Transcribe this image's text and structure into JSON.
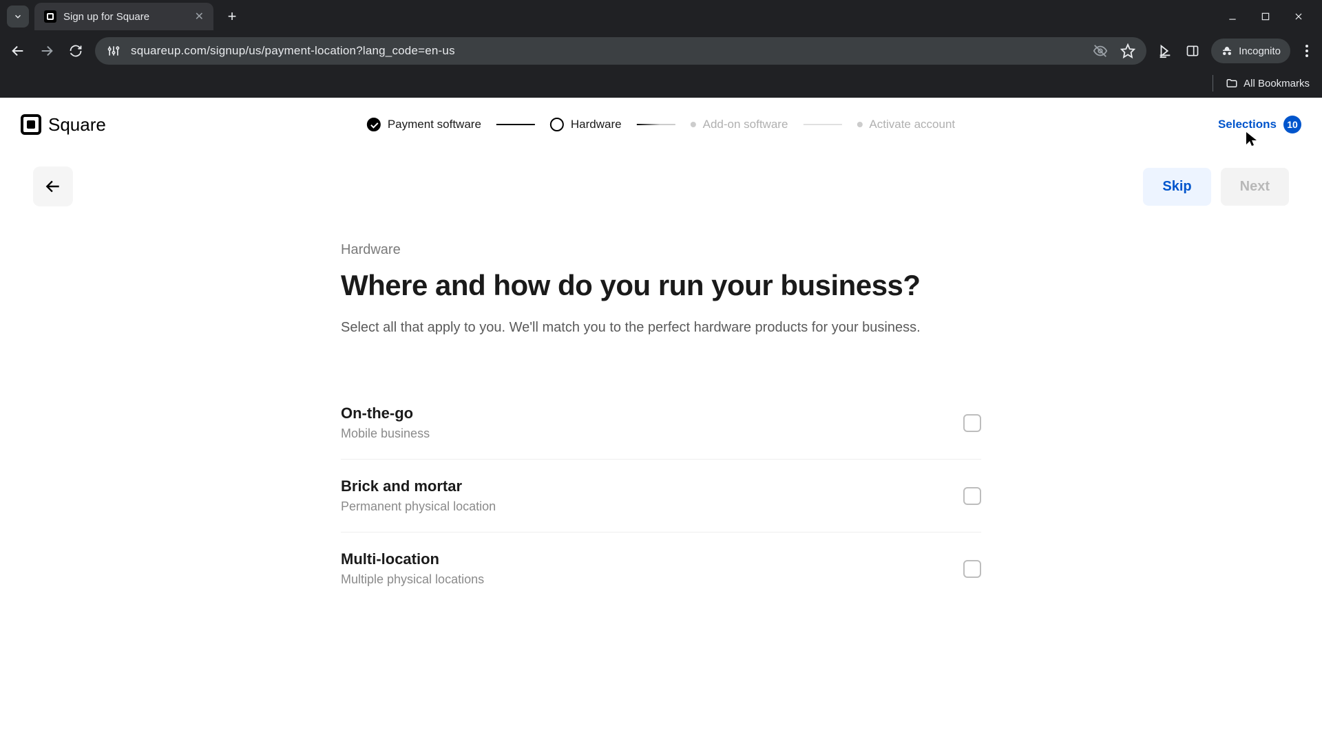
{
  "browser": {
    "tab_title": "Sign up for Square",
    "url_display": "squareup.com/signup/us/payment-location?lang_code=en-us",
    "incognito_label": "Incognito",
    "all_bookmarks": "All Bookmarks"
  },
  "header": {
    "brand": "Square",
    "steps": [
      {
        "label": "Payment software",
        "state": "done"
      },
      {
        "label": "Hardware",
        "state": "current"
      },
      {
        "label": "Add-on software",
        "state": "upcoming"
      },
      {
        "label": "Activate account",
        "state": "upcoming"
      }
    ],
    "selections_label": "Selections",
    "selections_count": "10"
  },
  "nav": {
    "skip": "Skip",
    "next": "Next"
  },
  "main": {
    "eyebrow": "Hardware",
    "headline": "Where and how do you run your business?",
    "subhead": "Select all that apply to you. We'll match you to the perfect hardware products for your business."
  },
  "options": [
    {
      "title": "On-the-go",
      "sub": "Mobile business"
    },
    {
      "title": "Brick and mortar",
      "sub": "Permanent physical location"
    },
    {
      "title": "Multi-location",
      "sub": "Multiple physical locations"
    }
  ]
}
